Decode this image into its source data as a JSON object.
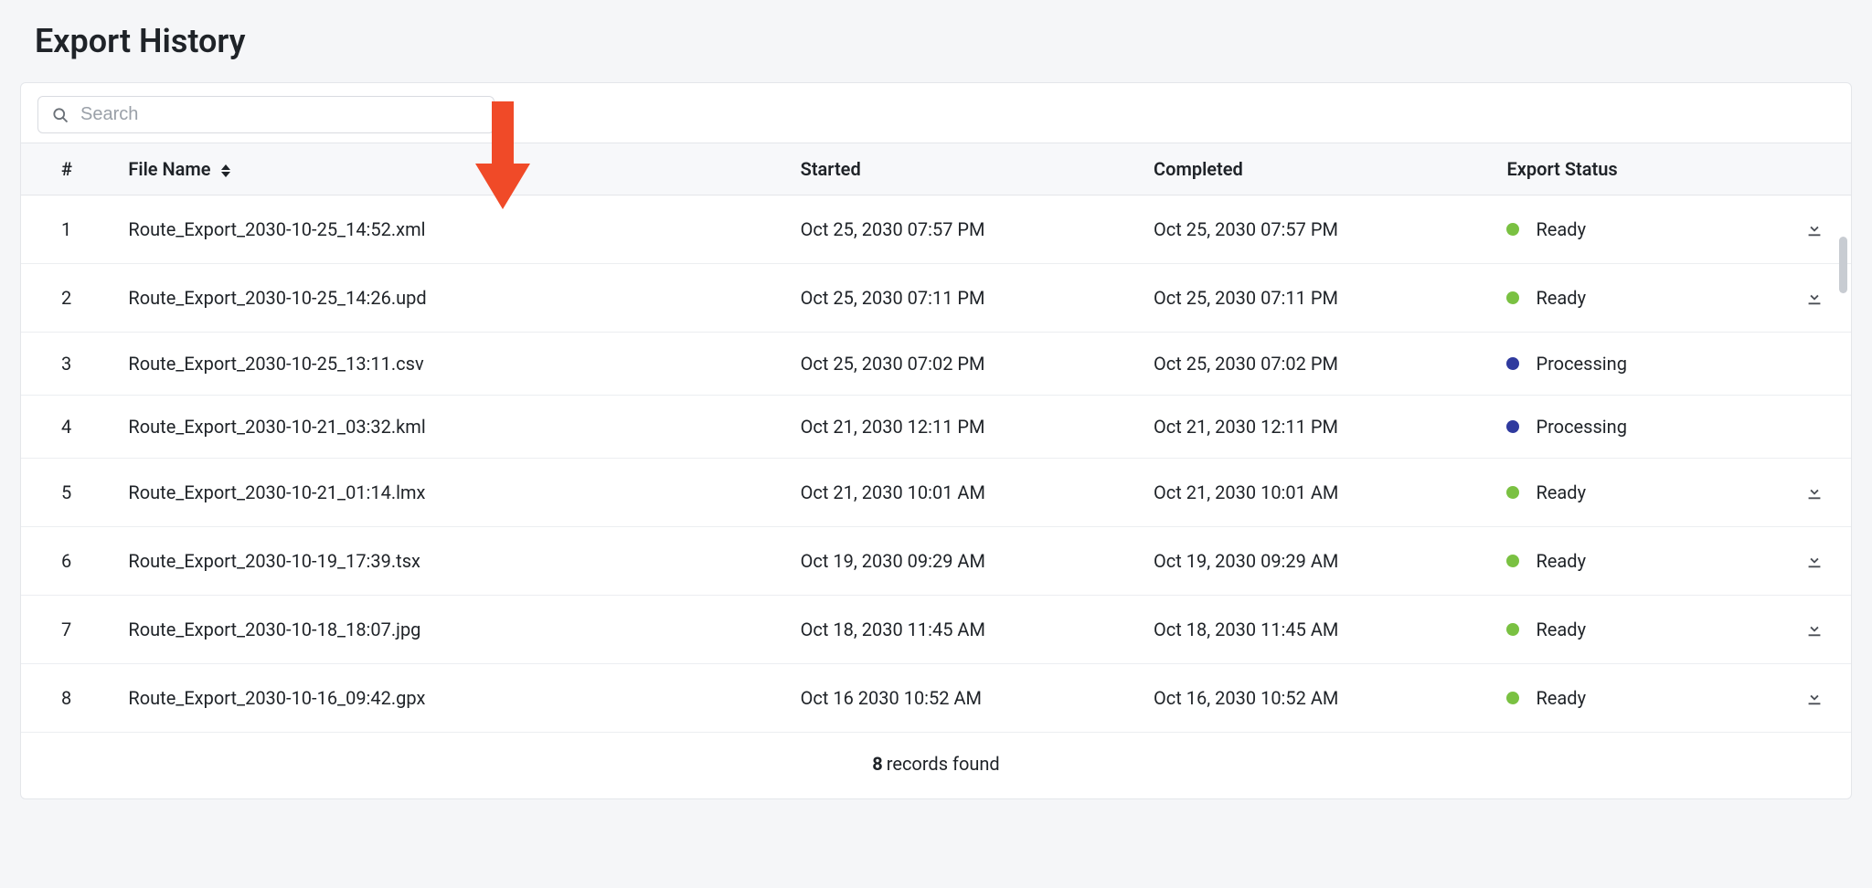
{
  "page": {
    "title": "Export History"
  },
  "search": {
    "placeholder": "Search",
    "value": ""
  },
  "columns": {
    "num": "#",
    "file": "File Name",
    "started": "Started",
    "completed": "Completed",
    "status": "Export Status"
  },
  "statusColors": {
    "Ready": "#7ac142",
    "Processing": "#2f3a9e"
  },
  "rows": [
    {
      "num": "1",
      "file": "Route_Export_2030-10-25_14:52.xml",
      "started": "Oct 25, 2030 07:57 PM",
      "completed": "Oct 25, 2030 07:57 PM",
      "status": "Ready",
      "downloadable": true
    },
    {
      "num": "2",
      "file": "Route_Export_2030-10-25_14:26.upd",
      "started": "Oct 25, 2030 07:11 PM",
      "completed": "Oct 25, 2030 07:11 PM",
      "status": "Ready",
      "downloadable": true
    },
    {
      "num": "3",
      "file": "Route_Export_2030-10-25_13:11.csv",
      "started": "Oct 25, 2030 07:02 PM",
      "completed": "Oct 25, 2030 07:02 PM",
      "status": "Processing",
      "downloadable": false
    },
    {
      "num": "4",
      "file": "Route_Export_2030-10-21_03:32.kml",
      "started": "Oct 21, 2030 12:11 PM",
      "completed": "Oct 21, 2030 12:11 PM",
      "status": "Processing",
      "downloadable": false
    },
    {
      "num": "5",
      "file": "Route_Export_2030-10-21_01:14.lmx",
      "started": "Oct 21, 2030 10:01 AM",
      "completed": "Oct 21, 2030 10:01 AM",
      "status": "Ready",
      "downloadable": true
    },
    {
      "num": "6",
      "file": "Route_Export_2030-10-19_17:39.tsx",
      "started": "Oct 19, 2030 09:29 AM",
      "completed": "Oct 19, 2030 09:29 AM",
      "status": "Ready",
      "downloadable": true
    },
    {
      "num": "7",
      "file": "Route_Export_2030-10-18_18:07.jpg",
      "started": "Oct 18, 2030 11:45 AM",
      "completed": "Oct 18, 2030 11:45 AM",
      "status": "Ready",
      "downloadable": true
    },
    {
      "num": "8",
      "file": "Route_Export_2030-10-16_09:42.gpx",
      "started": "Oct 16 2030 10:52 AM",
      "completed": "Oct 16, 2030 10:52 AM",
      "status": "Ready",
      "downloadable": true
    }
  ],
  "footer": {
    "count": "8",
    "label": "records found"
  },
  "annotation": {
    "arrowColor": "#f04a28"
  }
}
